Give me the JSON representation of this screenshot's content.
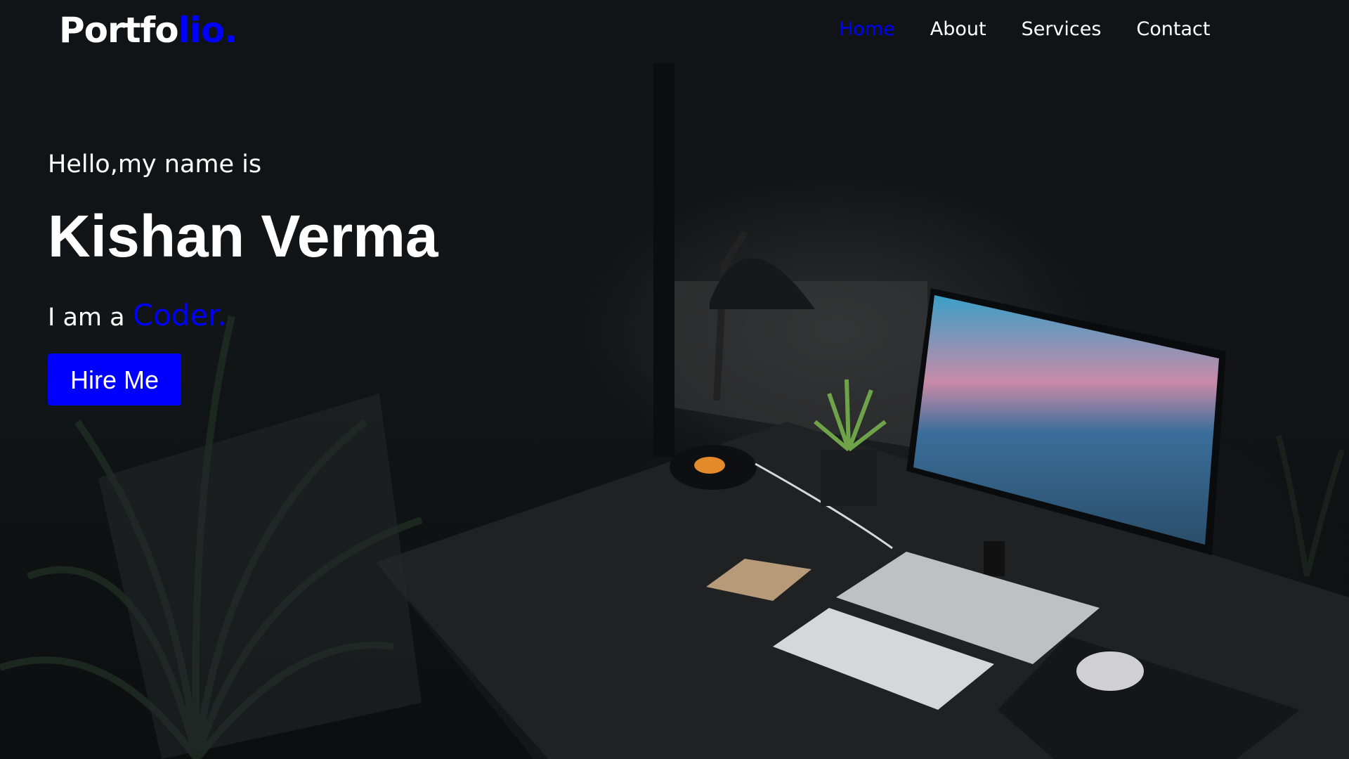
{
  "logo": {
    "main": "Portfo",
    "accent": "lio."
  },
  "nav": {
    "items": [
      {
        "label": "Home",
        "active": true
      },
      {
        "label": "About",
        "active": false
      },
      {
        "label": "Services",
        "active": false
      },
      {
        "label": "Contact",
        "active": false
      }
    ]
  },
  "hero": {
    "greeting": "Hello,my name is",
    "name": "Kishan Verma",
    "role_prefix": "I am a ",
    "role_highlight": "Coder.",
    "cta_label": "Hire Me"
  },
  "colors": {
    "accent": "#0000ff",
    "text": "#ffffff",
    "background": "#101416"
  }
}
